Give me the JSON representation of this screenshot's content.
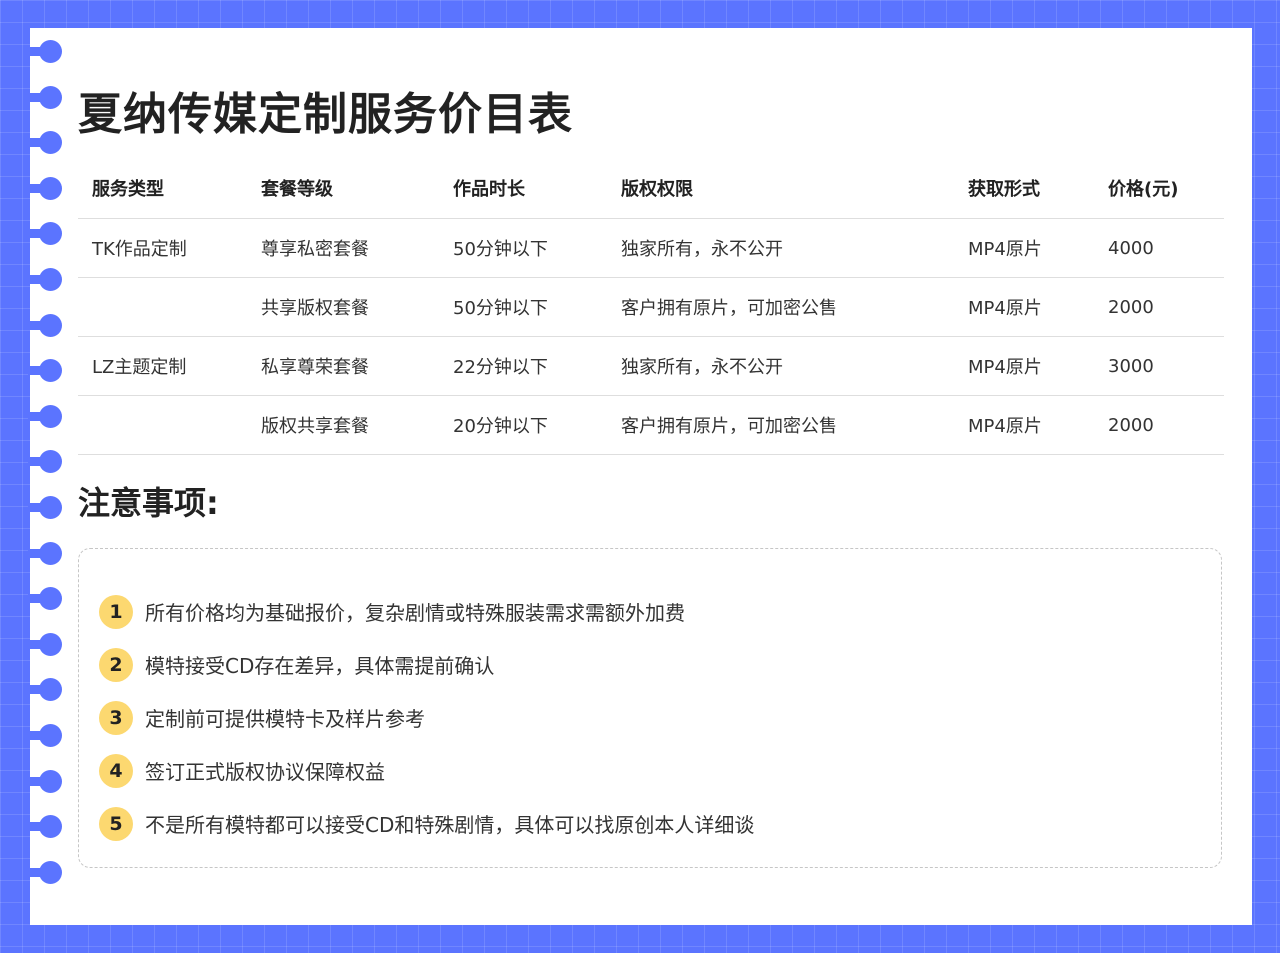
{
  "title": "夏纳传媒定制服务价目表",
  "table": {
    "headers": [
      "服务类型",
      "套餐等级",
      "作品时长",
      "版权权限",
      "获取形式",
      "价格(元)"
    ],
    "rows": [
      [
        "TK作品定制",
        "尊享私密套餐",
        "50分钟以下",
        "独家所有，永不公开",
        "MP4原片",
        "4000"
      ],
      [
        "",
        "共享版权套餐",
        "50分钟以下",
        "客户拥有原片，可加密公售",
        "MP4原片",
        "2000"
      ],
      [
        "LZ主题定制",
        "私享尊荣套餐",
        "22分钟以下",
        "独家所有，永不公开",
        "MP4原片",
        "3000"
      ],
      [
        "",
        "版权共享套餐",
        "20分钟以下",
        "客户拥有原片，可加密公售",
        "MP4原片",
        "2000"
      ]
    ]
  },
  "notes": {
    "title": "注意事项:",
    "items": [
      {
        "num": "1",
        "text": "所有价格均为基础报价，复杂剧情或特殊服装需求需额外加费"
      },
      {
        "num": "2",
        "text": "模特接受CD存在差异，具体需提前确认"
      },
      {
        "num": "3",
        "text": "定制前可提供模特卡及样片参考"
      },
      {
        "num": "4",
        "text": "签订正式版权协议保障权益"
      },
      {
        "num": "5",
        "text": "不是所有模特都可以接受CD和特殊剧情，具体可以找原创本人详细谈"
      }
    ]
  },
  "colors": {
    "background": "#5b74ff",
    "badge": "#fcd870"
  }
}
